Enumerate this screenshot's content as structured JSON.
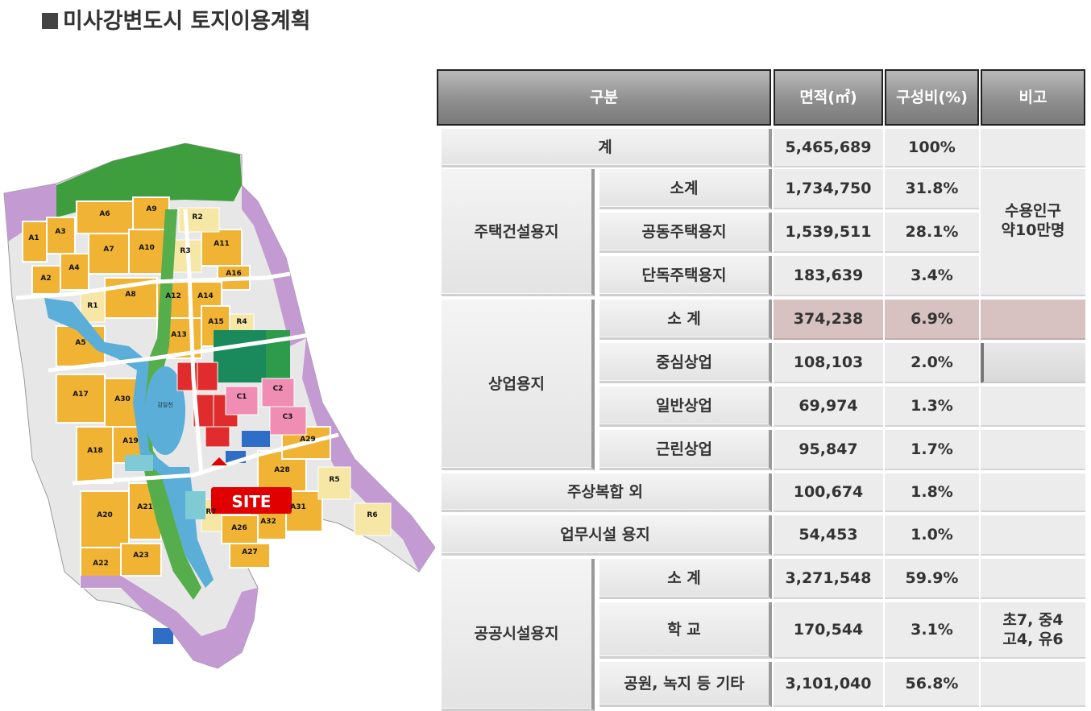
{
  "title": "미사강변도시 토지이용계획",
  "map": {
    "site_label": "SITE",
    "lake_label": "감일천",
    "blocks": [
      "A1",
      "A2",
      "A3",
      "A4",
      "A5",
      "A6",
      "A7",
      "A8",
      "A9",
      "A10",
      "A11",
      "A12",
      "A13",
      "A14",
      "A15",
      "A16",
      "A17",
      "A18",
      "A19",
      "A20",
      "A21",
      "A22",
      "A23",
      "A26",
      "A27",
      "A28",
      "A29",
      "A30",
      "A31",
      "A32",
      "C1",
      "C2",
      "C3",
      "R1",
      "R2",
      "R3",
      "R4",
      "R5",
      "R6",
      "R7"
    ]
  },
  "table": {
    "headers": {
      "category": "구분",
      "area": "면적(㎡)",
      "ratio": "구성비(%)",
      "note": "비고"
    },
    "total": {
      "label": "계",
      "area": "5,465,689",
      "ratio": "100%"
    },
    "housing": {
      "label": "주택건설용지",
      "rows": [
        {
          "label": "소계",
          "area": "1,734,750",
          "ratio": "31.8%"
        },
        {
          "label": "공동주택용지",
          "area": "1,539,511",
          "ratio": "28.1%"
        },
        {
          "label": "단독주택용지",
          "area": "183,639",
          "ratio": "3.4%"
        }
      ],
      "note": "수용인구\n약10만명"
    },
    "commercial": {
      "label": "상업용지",
      "rows": [
        {
          "label": "소 계",
          "area": "374,238",
          "ratio": "6.9%"
        },
        {
          "label": "중심상업",
          "area": "108,103",
          "ratio": "2.0%"
        },
        {
          "label": "일반상업",
          "area": "69,974",
          "ratio": "1.3%"
        },
        {
          "label": "근린상업",
          "area": "95,847",
          "ratio": "1.7%"
        }
      ]
    },
    "mixed": {
      "label": "주상복합 외",
      "area": "100,674",
      "ratio": "1.8%"
    },
    "business": {
      "label": "업무시설 용지",
      "area": "54,453",
      "ratio": "1.0%"
    },
    "public": {
      "label": "공공시설용지",
      "rows": [
        {
          "label": "소 계",
          "area": "3,271,548",
          "ratio": "59.9%"
        },
        {
          "label": "학 교",
          "area": "170,544",
          "ratio": "3.1%"
        },
        {
          "label": "공원, 녹지 등 기타",
          "area": "3,101,040",
          "ratio": "56.8%"
        }
      ],
      "school_note": "초7, 중4\n고4, 유6"
    }
  }
}
